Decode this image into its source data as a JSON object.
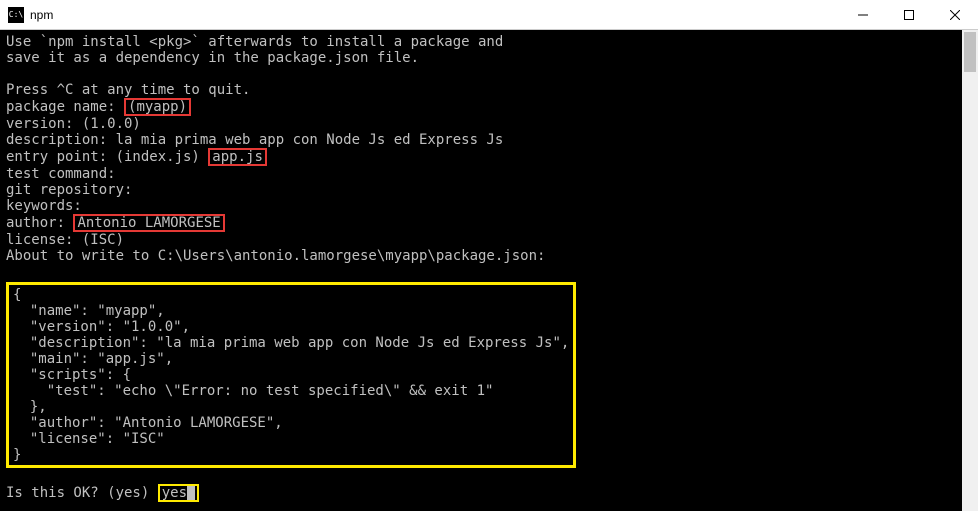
{
  "window": {
    "title": "npm",
    "icon_text": "C:\\"
  },
  "term": {
    "intro1": "Use `npm install <pkg>` afterwards to install a package and",
    "intro2": "save it as a dependency in the package.json file.",
    "quit": "Press ^C at any time to quit.",
    "pkg_label": "package name: ",
    "pkg_value": "(myapp)",
    "version": "version: (1.0.0)",
    "description": "description: la mia prima web app con Node Js ed Express Js",
    "entry_label": "entry point: (index.js) ",
    "entry_value": "app.js",
    "testcmd": "test command:",
    "gitrepo": "git repository:",
    "keywords": "keywords:",
    "author_label": "author: ",
    "author_value": "Antonio LAMORGESE",
    "license": "license: (ISC)",
    "about": "About to write to C:\\Users\\antonio.lamorgese\\myapp\\package.json:",
    "json_text": "{\n  \"name\": \"myapp\",\n  \"version\": \"1.0.0\",\n  \"description\": \"la mia prima web app con Node Js ed Express Js\",\n  \"main\": \"app.js\",\n  \"scripts\": {\n    \"test\": \"echo \\\"Error: no test specified\\\" && exit 1\"\n  },\n  \"author\": \"Antonio LAMORGESE\",\n  \"license\": \"ISC\"\n}",
    "ok_label": "Is this OK? (yes) ",
    "ok_value": "yes"
  }
}
